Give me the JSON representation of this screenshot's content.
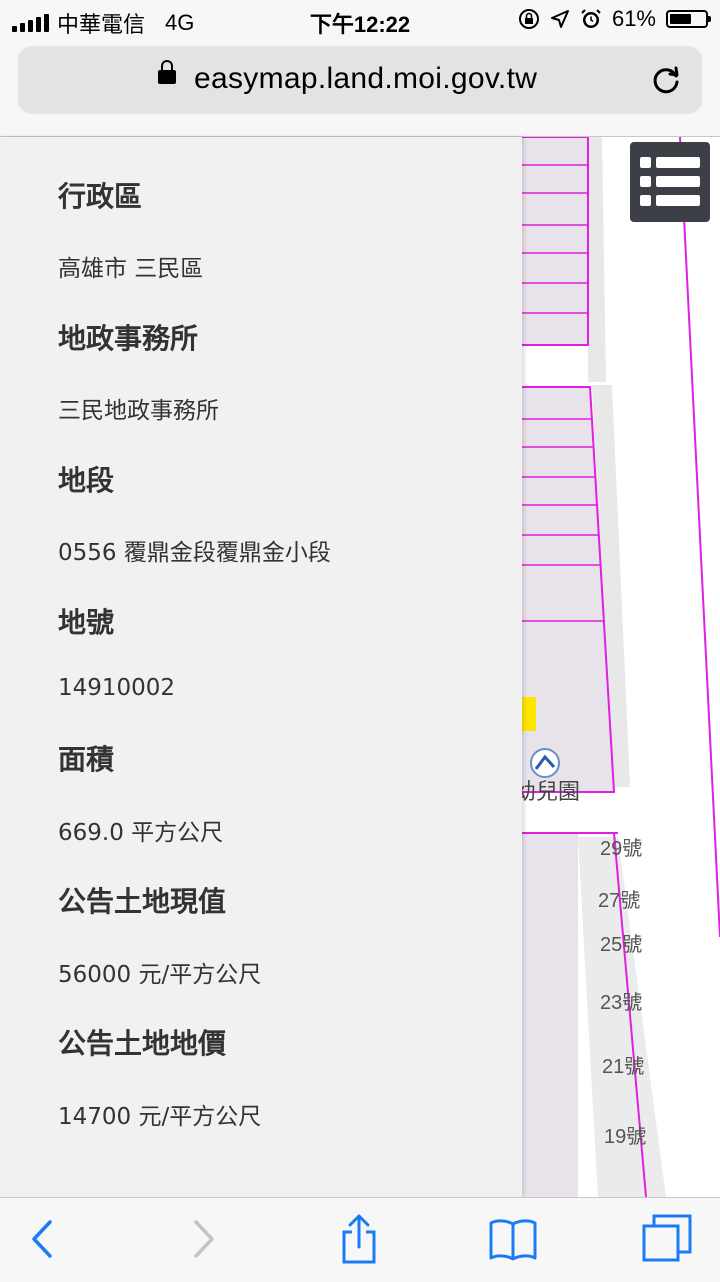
{
  "status_bar": {
    "carrier": "中華電信",
    "network": "4G",
    "time": "下午12:22",
    "battery": "61%",
    "battery_level": 0.61
  },
  "browser": {
    "host": "easymap.land.moi.gov.tw"
  },
  "info_panel": {
    "fields": [
      {
        "title": "行政區",
        "value": "高雄市 三民區"
      },
      {
        "title": "地政事務所",
        "value": "三民地政事務所"
      },
      {
        "title": "地段",
        "value": "0556 覆鼎金段覆鼎金小段"
      },
      {
        "title": "地號",
        "value": "14910002"
      },
      {
        "title": "面積",
        "value": "669.0 平方公尺"
      },
      {
        "title": "公告土地現值",
        "value": "56000 元/平方公尺"
      },
      {
        "title": "公告土地地價",
        "value": "14700 元/平方公尺"
      }
    ]
  },
  "map": {
    "house_numbers": [
      "29號",
      "27號",
      "25號",
      "23號",
      "21號",
      "19號"
    ],
    "parcel_numbers": [
      "29",
      "27",
      "25",
      "23",
      "21",
      "19"
    ],
    "place_label": "幼兒園",
    "parcel_color": "#e020e0"
  },
  "toolbar": {
    "icons": [
      "back-icon",
      "forward-icon",
      "share-icon",
      "bookmarks-icon",
      "tabs-icon"
    ]
  }
}
